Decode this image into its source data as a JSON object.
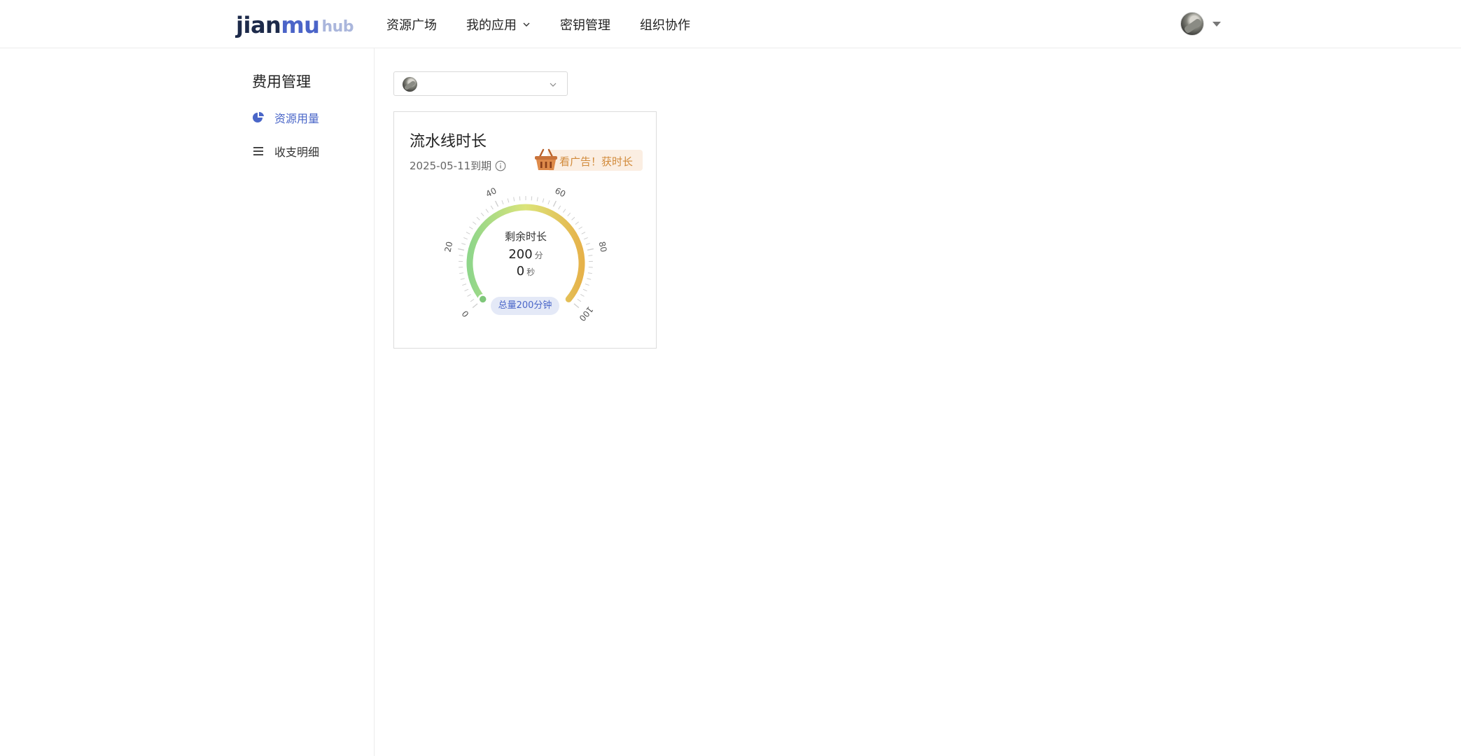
{
  "header": {
    "logo": {
      "part1": "jian",
      "part2": "mu",
      "part3": "hub"
    },
    "nav": [
      {
        "label": "资源广场"
      },
      {
        "label": "我的应用",
        "has_dropdown": true
      },
      {
        "label": "密钥管理"
      },
      {
        "label": "组织协作"
      }
    ]
  },
  "sidebar": {
    "title": "费用管理",
    "items": [
      {
        "label": "资源用量",
        "icon": "pie-chart-icon",
        "active": true
      },
      {
        "label": "收支明细",
        "icon": "list-icon",
        "active": false
      }
    ]
  },
  "main": {
    "card": {
      "title": "流水线时长",
      "expire": "2025-05-11到期",
      "ad_button": "看广告！获时长",
      "gauge": {
        "title": "剩余时长",
        "minutes": "200",
        "minutes_unit": "分",
        "seconds": "0",
        "seconds_unit": "秒",
        "tick_labels": [
          "0",
          "20",
          "40",
          "60",
          "80",
          "100"
        ],
        "range": [
          0,
          100
        ],
        "value": 0
      },
      "total_badge": "总量200分钟"
    }
  },
  "colors": {
    "accent": "#4a66c8",
    "gauge_start": "#8fd68a",
    "gauge_mid": "#dce47a",
    "gauge_end": "#e6b24a",
    "ad_text": "#d18a3a"
  }
}
